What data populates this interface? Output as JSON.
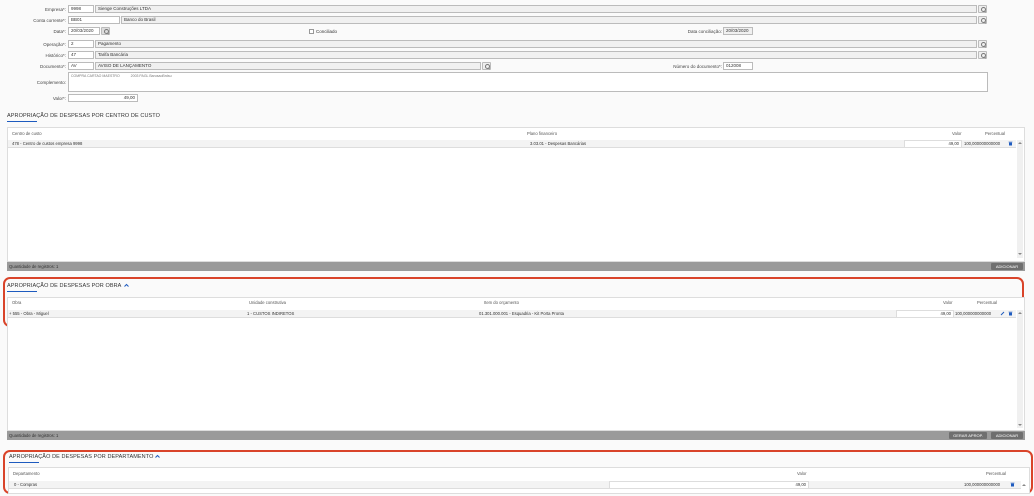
{
  "form": {
    "empresa_label": "Empresa*:",
    "empresa_code": "9998",
    "empresa_name": "Sienge Construções LTDA",
    "conta_label": "Conta corrente*:",
    "conta_code": "BB01",
    "conta_name": "Banco do Brasil",
    "data_label": "Data*:",
    "data_value": "20/03/2020",
    "conciliado_label": "Conciliado",
    "data_conc_label": "Data conciliação:",
    "data_conc_value": "20/03/2020",
    "operacao_label": "Operação*:",
    "operacao_code": "2",
    "operacao_name": "Pagamento",
    "historico_label": "Histórico*:",
    "historico_code": "47",
    "historico_name": "Tarifa Bancária",
    "documento_label": "Documento*:",
    "documento_code": "AV",
    "documento_name": "AVISO DE LANÇAMENTO",
    "numdoc_label": "Número do documento*:",
    "numdoc_value": "012008",
    "complemento_label": "Complemento:",
    "complemento_value_1": "COMPRA CARTAO MAESTRO",
    "complemento_value_2": "2003 PAGL BarusaoBrdsu",
    "valor_label": "Valor*:",
    "valor_value": "49,00"
  },
  "centro_custo": {
    "title": "APROPRIAÇÃO DE DESPESAS POR CENTRO DE CUSTO",
    "headers": {
      "c1": "Centro de custo",
      "c2": "Plano financeiro",
      "c3": "Valor",
      "c4": "Percentual"
    },
    "row": {
      "centro": "478 - Centro de custos empresa 9998",
      "plano": "3.03.01 - Despesas Bancárias",
      "valor": "49,00",
      "percentual": "100,000000000000"
    },
    "footer_text": "Quantidade de registros: 1",
    "add_button": "ADICIONAR"
  },
  "obra": {
    "title": "APROPRIAÇÃO DE DESPESAS POR OBRA",
    "headers": {
      "c1": "Obra",
      "c2": "Unidade construtiva",
      "c3": "Item do orçamento",
      "c4": "Valor",
      "c5": "Percentual"
    },
    "row": {
      "obra": "+ 555 - Obra - Miguel",
      "unidade": "1 - CUSTOS INDIRETOS",
      "item": "01.301.000.001 - Esquadria - Kit Porta Pronta",
      "valor": "49,00",
      "percentual": "100,000000000000"
    },
    "footer_text": "Quantidade de registros: 1",
    "gerar_button": "GERAR APROP.",
    "add_button": "ADICIONAR"
  },
  "departamento": {
    "title": "APROPRIAÇÃO DE DESPESAS POR DEPARTAMENTO",
    "headers": {
      "c1": "Departamento",
      "c2": "Valor",
      "c3": "Percentual"
    },
    "row": {
      "departamento": "0 - Compras",
      "valor": "49,00",
      "percentual": "100,000000000000"
    }
  },
  "colors": {
    "accent": "#1e5bbf",
    "highlight": "#d9442a",
    "footer": "#9a9a9a"
  }
}
